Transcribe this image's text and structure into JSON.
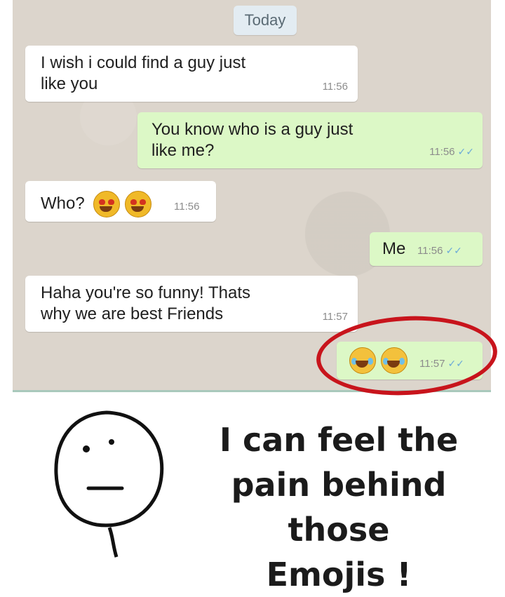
{
  "chat": {
    "date_chip": "Today",
    "messages": [
      {
        "direction": "incoming",
        "line1": "I wish i could find a guy just",
        "line2": "like you",
        "time": "11:56"
      },
      {
        "direction": "outgoing",
        "line1": "You know who is a guy just",
        "line2": "like me?",
        "time": "11:56"
      },
      {
        "direction": "incoming",
        "text": "Who?",
        "emoji": "heart-eyes-icon",
        "time": "11:56"
      },
      {
        "direction": "outgoing",
        "text": "Me",
        "time": "11:56"
      },
      {
        "direction": "incoming",
        "line1": "Haha you're so funny! Thats",
        "line2": "why we are best Friends",
        "time": "11:57"
      },
      {
        "direction": "outgoing",
        "emoji": "laughing-tears-icon",
        "time": "11:57"
      }
    ],
    "colors": {
      "incoming": "#ffffff",
      "outgoing": "#dcf8c6",
      "highlight_ring": "#c8141c"
    }
  },
  "caption": {
    "line1": "I can feel the",
    "line2": "pain behind those",
    "line3": "Emojis !"
  }
}
